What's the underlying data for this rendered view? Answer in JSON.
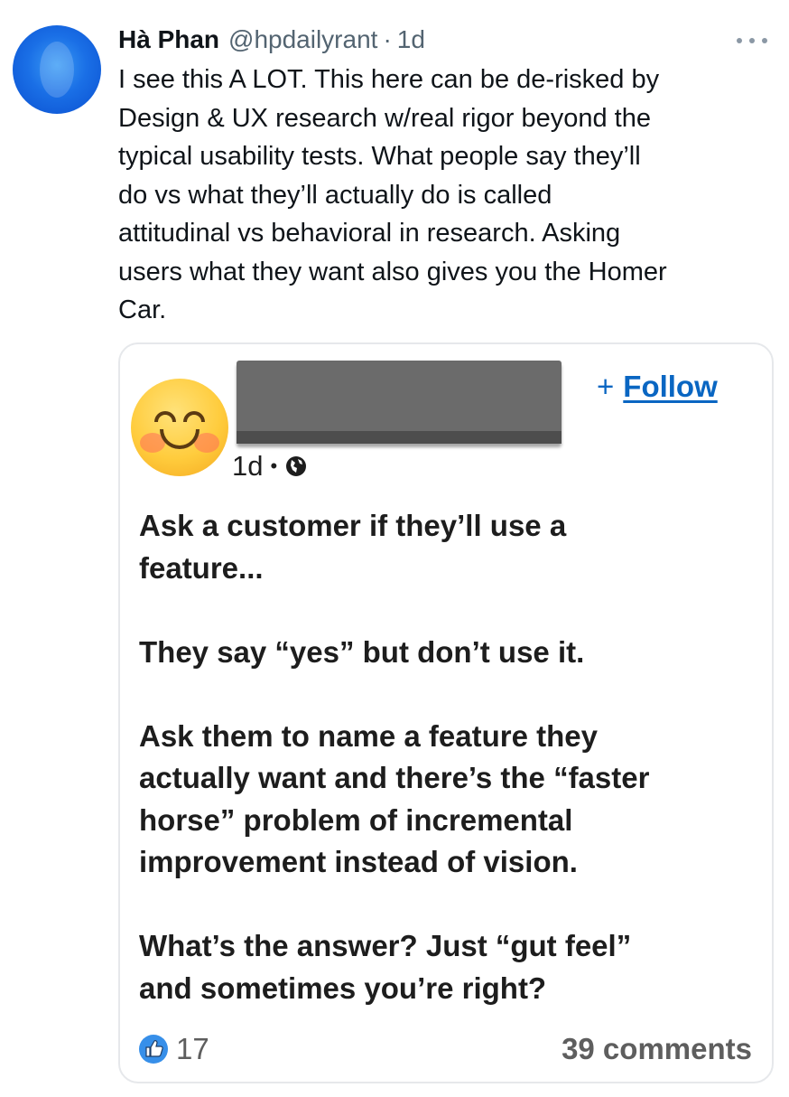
{
  "tweet": {
    "author_name": "Hà Phan",
    "handle": "@hpdailyrant",
    "separator": "·",
    "time": "1d",
    "text": "I see this A LOT. This here can be de-risked by\nDesign & UX research w/real rigor beyond the\ntypical usability tests. What people say they’ll\ndo vs what they’ll actually do is called\nattitudinal vs behavioral in research. Asking\nusers what they want also gives you the Homer\nCar.",
    "more_icon": "more-horizontal-icon"
  },
  "embedded_post": {
    "follow_plus": "+",
    "follow_label": "Follow",
    "time": "1d",
    "separator": "•",
    "visibility_icon": "globe-icon",
    "text": "Ask a customer if they’ll use a\nfeature...\n\nThey say “yes” but don’t use it.\n\nAsk them to name a feature they\nactually want and there’s the “faster\nhorse” problem of incremental\nimprovement instead of vision.\n\nWhat’s the answer? Just “gut feel”\nand sometimes you’re right?",
    "likes": "17",
    "comments": "39 comments",
    "colors": {
      "follow": "#0a66c2",
      "like_icon": "#378fe9"
    }
  }
}
